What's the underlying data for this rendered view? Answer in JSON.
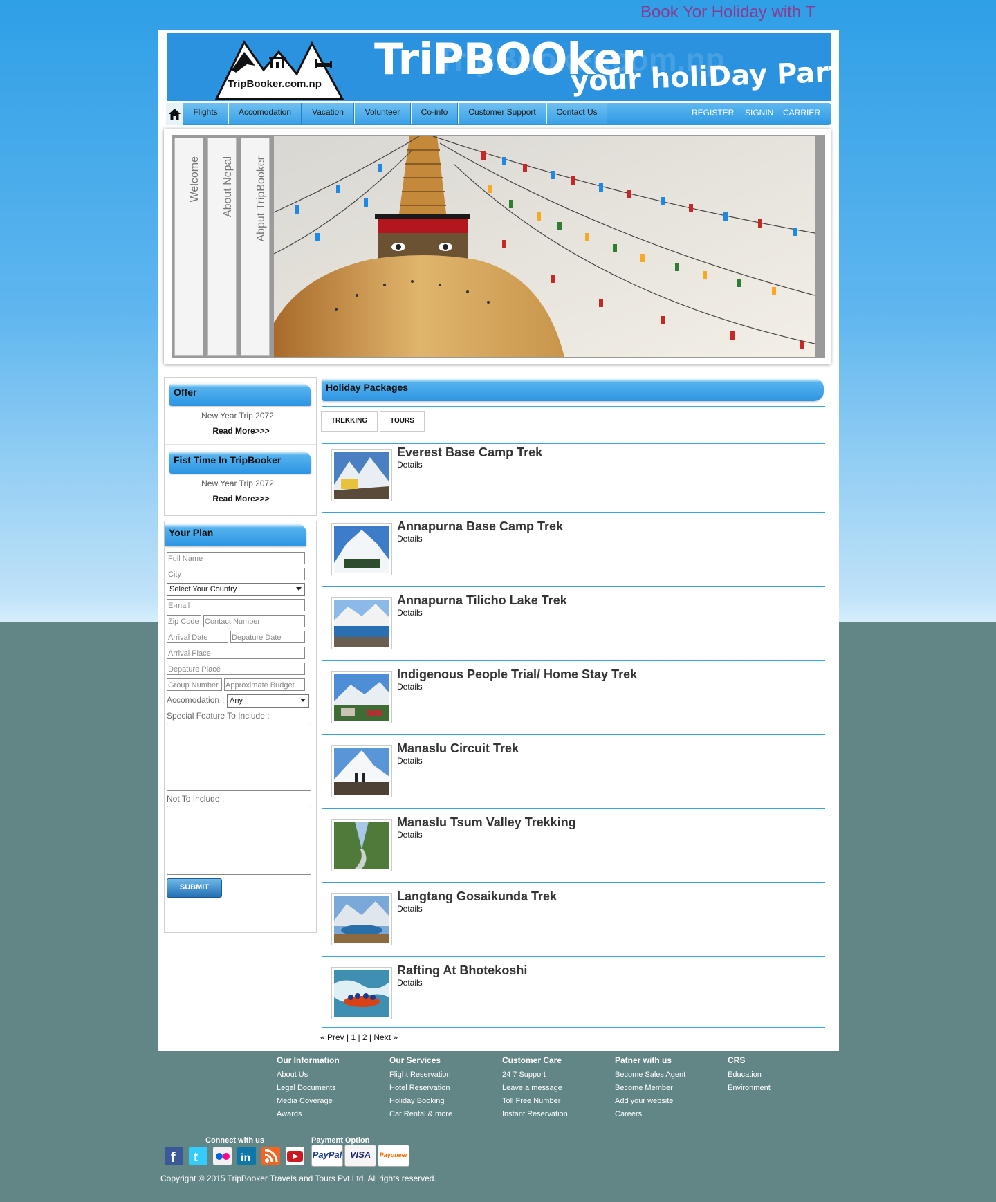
{
  "marquee": "Book Yor Holiday with T",
  "header": {
    "logo_text": "TripBooker.com.np",
    "brand": "TriPBOOker",
    "tagline": "your holiDay Partner"
  },
  "nav": {
    "items": [
      "Flights",
      "Accomodation",
      "Vacation",
      "Volunteer",
      "Co-info",
      "Customer Support",
      "Contact Us"
    ],
    "right": [
      "REGISTER",
      "SIGNIN",
      "CARRIER"
    ]
  },
  "slider": {
    "tabs": [
      "Welcome",
      "About Nepal",
      "Abput TripBooker"
    ]
  },
  "offer": {
    "title": "Offer",
    "text": "New Year Trip 2072",
    "more": "Read More>>>"
  },
  "first_time": {
    "title": "Fist Time In TripBooker",
    "text": "New Year Trip 2072",
    "more": "Read More>>>"
  },
  "plan": {
    "title": "Your Plan",
    "full_name": "Full Name",
    "city": "City",
    "country": "Select Your Country",
    "email": "E-mail",
    "zip": "Zip Code",
    "contact": "Contact Number",
    "arrival_date": "Arrival Date",
    "departure_date": "Depature Date",
    "arrival_place": "Arrival Place",
    "departure_place": "Depature Place",
    "group": "Group Number",
    "budget": "Approximate Budget",
    "accom_label": "Accomodation",
    "accom_colon": ":",
    "accom_value": "Any",
    "special_label": "Special Feature To Include :",
    "not_label": "Not To Include :",
    "submit": "SUBMIT"
  },
  "packages": {
    "title": "Holiday Packages",
    "tabs": [
      "TREKKING",
      "TOURS"
    ],
    "items": [
      {
        "title": "Everest Base Camp Trek",
        "details": "Details"
      },
      {
        "title": "Annapurna Base Camp Trek",
        "details": "Details"
      },
      {
        "title": "Annapurna Tilicho Lake Trek",
        "details": "Details"
      },
      {
        "title": "Indigenous People Trial/ Home Stay Trek",
        "details": "Details"
      },
      {
        "title": "Manaslu Circuit Trek",
        "details": "Details"
      },
      {
        "title": "Manaslu Tsum Valley Trekking",
        "details": "Details"
      },
      {
        "title": "Langtang Gosaikunda Trek",
        "details": "Details"
      },
      {
        "title": "Rafting At Bhotekoshi",
        "details": "Details"
      }
    ],
    "pager": "« Prev | 1 | 2 | Next »"
  },
  "footer": {
    "columns": [
      {
        "title": "Our Information",
        "links": [
          "About Us",
          "Legal Documents",
          "Media Coverage",
          "Awards"
        ]
      },
      {
        "title": "Our Services",
        "links": [
          "Flight Reservation",
          "Hotel Reservation",
          "Holiday Booking",
          "Car Rental & more"
        ]
      },
      {
        "title": "Customer Care",
        "links": [
          "24 7 Support",
          "Leave a message",
          "Toll Free Number",
          "Instant Reservation"
        ]
      },
      {
        "title": "Patner with us",
        "links": [
          "Become Sales Agent",
          "Become Member",
          "Add your website",
          "Careers"
        ]
      },
      {
        "title": "CRS",
        "links": [
          "Education",
          "Environment"
        ]
      }
    ],
    "connect": "Connect with us",
    "payment": "Payment Option",
    "pay_labels": [
      "PayPal",
      "VISA",
      "Payoneer"
    ],
    "copyright": "Copyright © 2015 TripBooker Travels and Tours Pvt.Ltd. All rights reserved."
  }
}
